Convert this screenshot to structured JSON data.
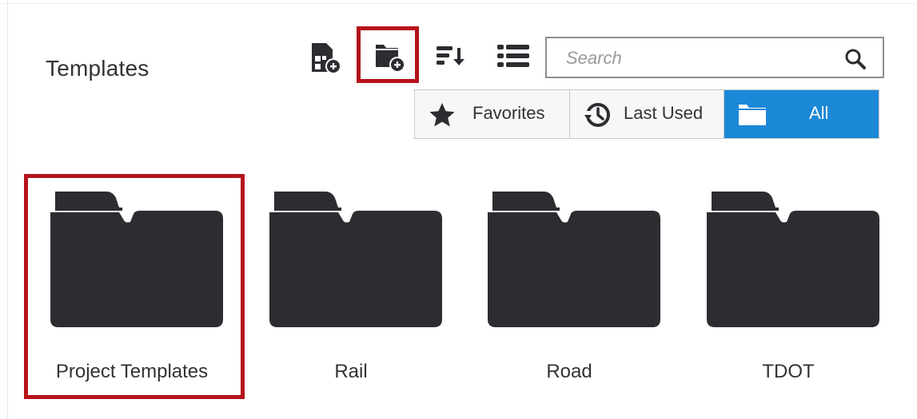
{
  "header": {
    "title": "Templates"
  },
  "toolbar": {
    "new_template_icon": "document-add-icon",
    "new_folder_icon": "folder-add-icon",
    "sort_icon": "sort-descending-icon",
    "view_icon": "list-view-icon",
    "search": {
      "placeholder": "Search",
      "value": "",
      "icon": "search-icon"
    }
  },
  "filters": {
    "selected": "All",
    "items": [
      {
        "label": "Favorites",
        "icon": "star-icon"
      },
      {
        "label": "Last Used",
        "icon": "history-icon"
      },
      {
        "label": "All",
        "icon": "folder-icon"
      }
    ]
  },
  "folders": [
    {
      "label": "Project Templates"
    },
    {
      "label": "Rail"
    },
    {
      "label": "Road"
    },
    {
      "label": "TDOT"
    }
  ],
  "colors": {
    "accent": "#1b88d8",
    "highlight": "#b5121b",
    "icon": "#2b2d31",
    "text": "#333333"
  }
}
